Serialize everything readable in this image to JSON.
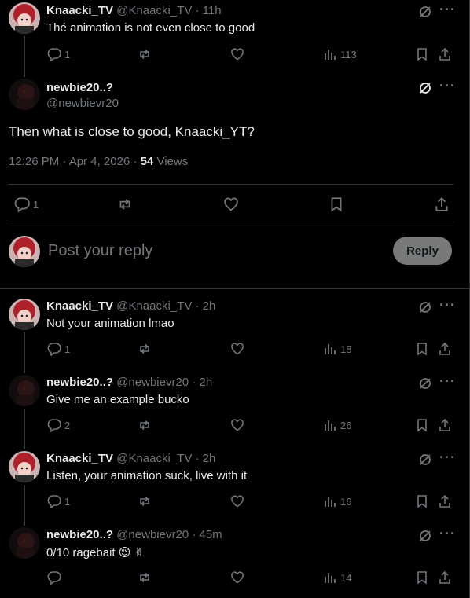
{
  "thread_top": {
    "author": "Knaacki_TV",
    "handle": "@Knaacki_TV",
    "time": "11h",
    "text": "Thé animation is not even close to good",
    "replies": "1",
    "views": "113"
  },
  "focus": {
    "author": "newbie20..?",
    "handle": "@newbievr20",
    "text": "Then what is close to good, Knaacki_YT?",
    "meta": "12:26 PM · Apr 4, 2026 ·",
    "views_num": "54",
    "views_label": "Views",
    "replies": "1"
  },
  "compose": {
    "placeholder": "Post your reply",
    "button": "Reply"
  },
  "replies": [
    {
      "author": "Knaacki_TV",
      "handle": "@Knaacki_TV",
      "time": "2h",
      "text": "Not your animation lmao",
      "replies": "1",
      "views": "18"
    },
    {
      "author": "newbie20..?",
      "handle": "@newbievr20",
      "time": "2h",
      "text": "Give me an example bucko",
      "replies": "2",
      "views": "26"
    },
    {
      "author": "Knaacki_TV",
      "handle": "@Knaacki_TV",
      "time": "2h",
      "text": "Listen, your animation suck, live with it",
      "replies": "1",
      "views": "16"
    },
    {
      "author": "newbie20..?",
      "handle": "@newbievr20",
      "time": "45m",
      "text": "0/10 ragebait 😌 ✌",
      "replies": "",
      "views": "14"
    }
  ],
  "separator": " · "
}
